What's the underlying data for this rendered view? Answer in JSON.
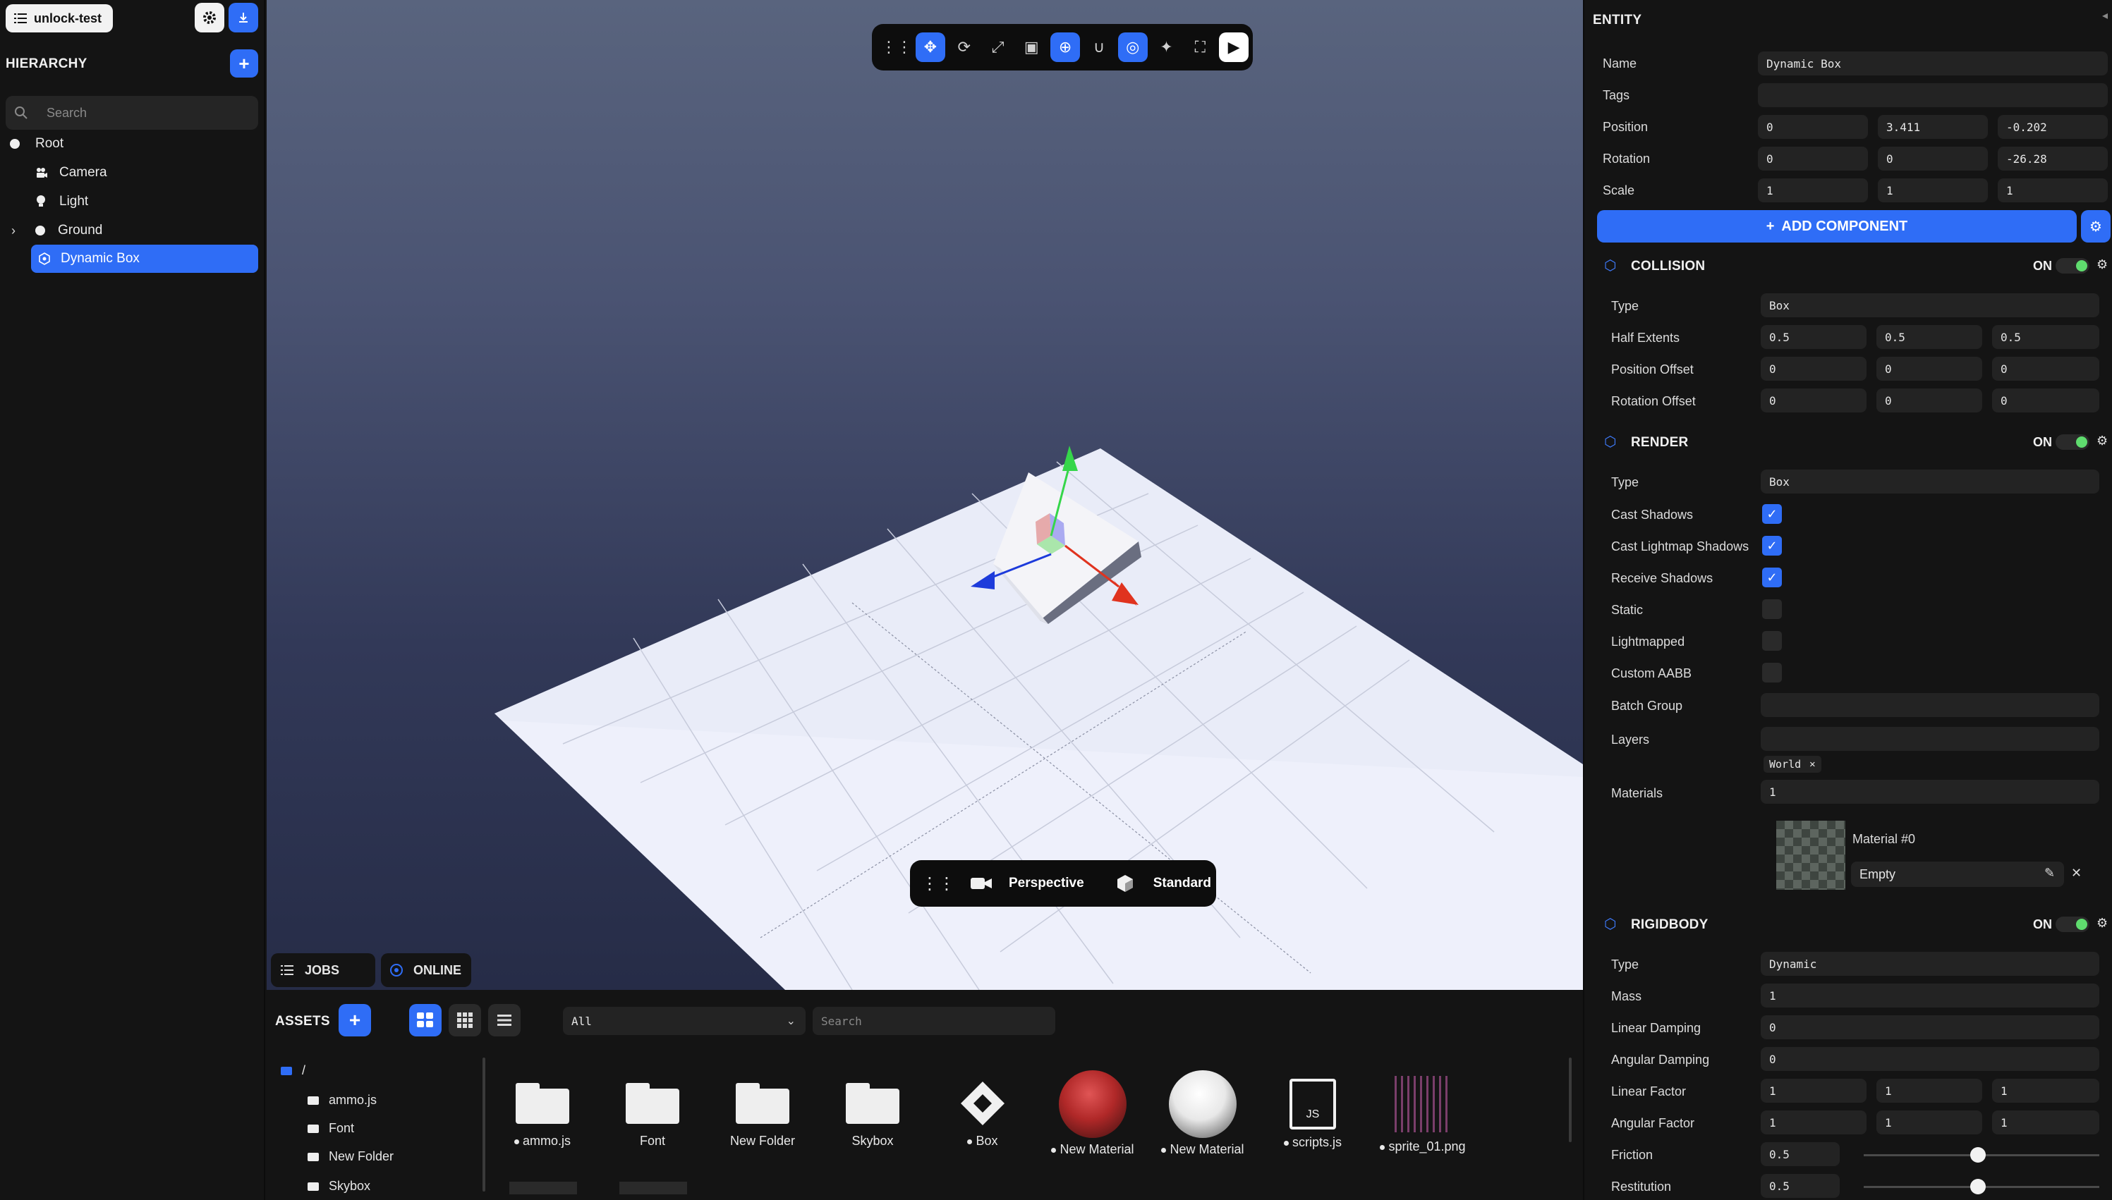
{
  "project": {
    "name": "unlock-test"
  },
  "hierarchy": {
    "title": "HIERARCHY",
    "search_placeholder": "Search",
    "items": [
      {
        "label": "Root"
      },
      {
        "label": "Camera"
      },
      {
        "label": "Light"
      },
      {
        "label": "Ground"
      },
      {
        "label": "Dynamic Box"
      }
    ]
  },
  "viewport": {
    "camera_mode": "Perspective",
    "render_mode": "Standard",
    "jobs_label": "JOBS",
    "online_label": "ONLINE"
  },
  "assets": {
    "title": "ASSETS",
    "filter_value": "All",
    "search_placeholder": "Search",
    "tree_root": "/",
    "tree": [
      "ammo.js",
      "Font",
      "New Folder",
      "Skybox"
    ],
    "items": [
      {
        "label": "ammo.js"
      },
      {
        "label": "Font"
      },
      {
        "label": "New Folder"
      },
      {
        "label": "Skybox"
      },
      {
        "label": "Box"
      },
      {
        "label": "New Material"
      },
      {
        "label": "New Material"
      },
      {
        "label": "scripts.js"
      },
      {
        "label": "sprite_01.png"
      }
    ],
    "js_badge": "JS"
  },
  "inspector": {
    "title": "ENTITY",
    "name_label": "Name",
    "name_value": "Dynamic Box",
    "tags_label": "Tags",
    "position_label": "Position",
    "position": [
      "0",
      "3.411",
      "-0.202"
    ],
    "rotation_label": "Rotation",
    "rotation": [
      "0",
      "0",
      "-26.28"
    ],
    "scale_label": "Scale",
    "scale": [
      "1",
      "1",
      "1"
    ],
    "add_component": "ADD COMPONENT",
    "on_label": "ON",
    "collision": {
      "title": "COLLISION",
      "type_label": "Type",
      "type_value": "Box",
      "half_extents_label": "Half Extents",
      "half_extents": [
        "0.5",
        "0.5",
        "0.5"
      ],
      "position_offset_label": "Position Offset",
      "position_offset": [
        "0",
        "0",
        "0"
      ],
      "rotation_offset_label": "Rotation Offset",
      "rotation_offset": [
        "0",
        "0",
        "0"
      ]
    },
    "render": {
      "title": "RENDER",
      "type_label": "Type",
      "type_value": "Box",
      "cast_shadows": "Cast Shadows",
      "cast_lightmap_shadows": "Cast Lightmap Shadows",
      "receive_shadows": "Receive Shadows",
      "static": "Static",
      "lightmapped": "Lightmapped",
      "custom_aabb": "Custom AABB",
      "batch_group": "Batch Group",
      "layers_label": "Layers",
      "layer_tag": "World",
      "materials_label": "Materials",
      "materials_count": "1",
      "material_name": "Material #0",
      "material_value": "Empty"
    },
    "rigidbody": {
      "title": "RIGIDBODY",
      "type_label": "Type",
      "type_value": "Dynamic",
      "mass_label": "Mass",
      "mass": "1",
      "linear_damping_label": "Linear Damping",
      "linear_damping": "0",
      "angular_damping_label": "Angular Damping",
      "angular_damping": "0",
      "linear_factor_label": "Linear Factor",
      "linear_factor": [
        "1",
        "1",
        "1"
      ],
      "angular_factor_label": "Angular Factor",
      "angular_factor": [
        "1",
        "1",
        "1"
      ],
      "friction_label": "Friction",
      "friction": "0.5",
      "restitution_label": "Restitution",
      "restitution": "0.5"
    }
  },
  "colors": {
    "accent": "#2f6df6",
    "toggle_on": "#5fdc6e",
    "panel_bg": "#141414",
    "field_bg": "#232323"
  }
}
